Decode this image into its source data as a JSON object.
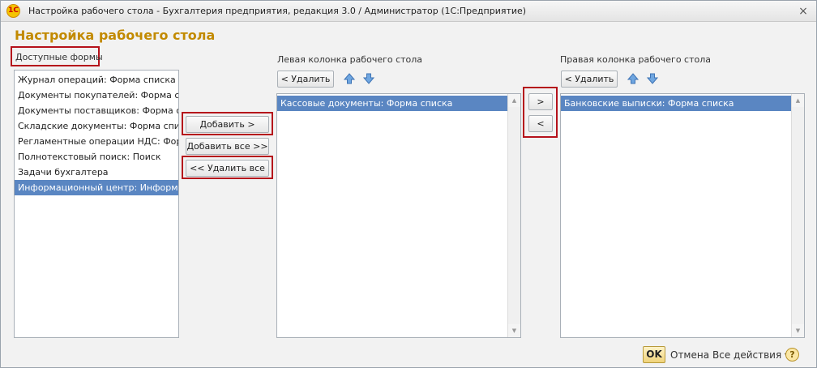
{
  "window": {
    "title": "Настройка рабочего стола - Бухгалтерия предприятия, редакция 3.0 / Администратор  (1С:Предприятие)",
    "app_icon": "1c-logo-icon",
    "app_icon_text": "1С",
    "close_glyph": "×"
  },
  "form": {
    "title": "Настройка рабочего стола"
  },
  "available": {
    "label": "Доступные формы",
    "items": [
      "Журнал операций: Форма списка",
      "Документы покупателей: Форма спи...",
      "Документы поставщиков: Форма с...",
      "Складские документы: Форма спис...",
      "Регламентные операции НДС: Фор...",
      "Полнотекстовый поиск: Поиск",
      "Задачи бухгалтера",
      "Информационный центр: Информац..."
    ],
    "selected_index": 7
  },
  "middle_buttons": {
    "add": "Добавить >",
    "add_all": "Добавить все >>",
    "remove_all": "<< Удалить все"
  },
  "left_column": {
    "label": "Левая колонка рабочего стола",
    "remove": "< Удалить",
    "items": [
      "Кассовые документы: Форма списка"
    ]
  },
  "move_buttons": {
    "to_right": ">",
    "to_left": "<"
  },
  "right_column": {
    "label": "Правая колонка рабочего стола",
    "remove": "< Удалить",
    "items": [
      "Банковские выписки: Форма списка"
    ]
  },
  "footer": {
    "ok": "OK",
    "cancel": "Отмена",
    "all_actions": "Все действия ▾",
    "help": "?"
  },
  "colors": {
    "title_accent": "#c28a00",
    "highlight_border": "#b5121b",
    "selection": "#5a86c2"
  }
}
